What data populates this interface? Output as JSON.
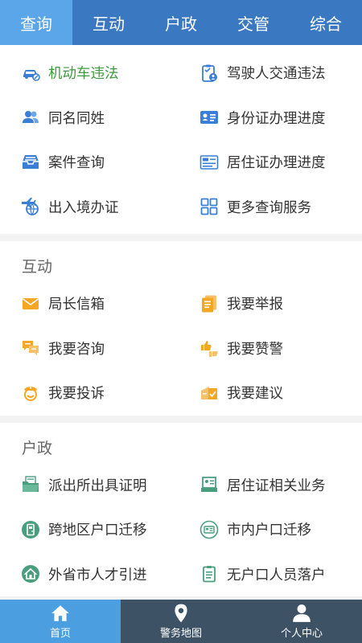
{
  "tabs": [
    "查询",
    "互动",
    "户政",
    "交管",
    "综合"
  ],
  "query": {
    "items": [
      "机动车违法",
      "驾驶人交通违法",
      "同名同姓",
      "身份证办理进度",
      "案件查询",
      "居住证办理进度",
      "出入境办证",
      "更多查询服务"
    ]
  },
  "interact": {
    "title": "互动",
    "items": [
      "局长信箱",
      "我要举报",
      "我要咨询",
      "我要赞警",
      "我要投诉",
      "我要建议"
    ]
  },
  "household": {
    "title": "户政",
    "items": [
      "派出所出具证明",
      "居住证相关业务",
      "跨地区户口迁移",
      "市内户口迁移",
      "外省市人才引进",
      "无户口人员落户"
    ]
  },
  "bottom_nav": [
    "首页",
    "警务地图",
    "个人中心"
  ],
  "colors": {
    "tabbar": "#3a78c2",
    "tab_active": "#5aa6e8",
    "bottombar": "#3e5266",
    "bottom_active": "#4b9ee0",
    "highlight": "#3e9a3e",
    "blue_icon": "#3a7fd5",
    "orange_icon": "#f5a623",
    "green_icon": "#4a9e7e"
  }
}
